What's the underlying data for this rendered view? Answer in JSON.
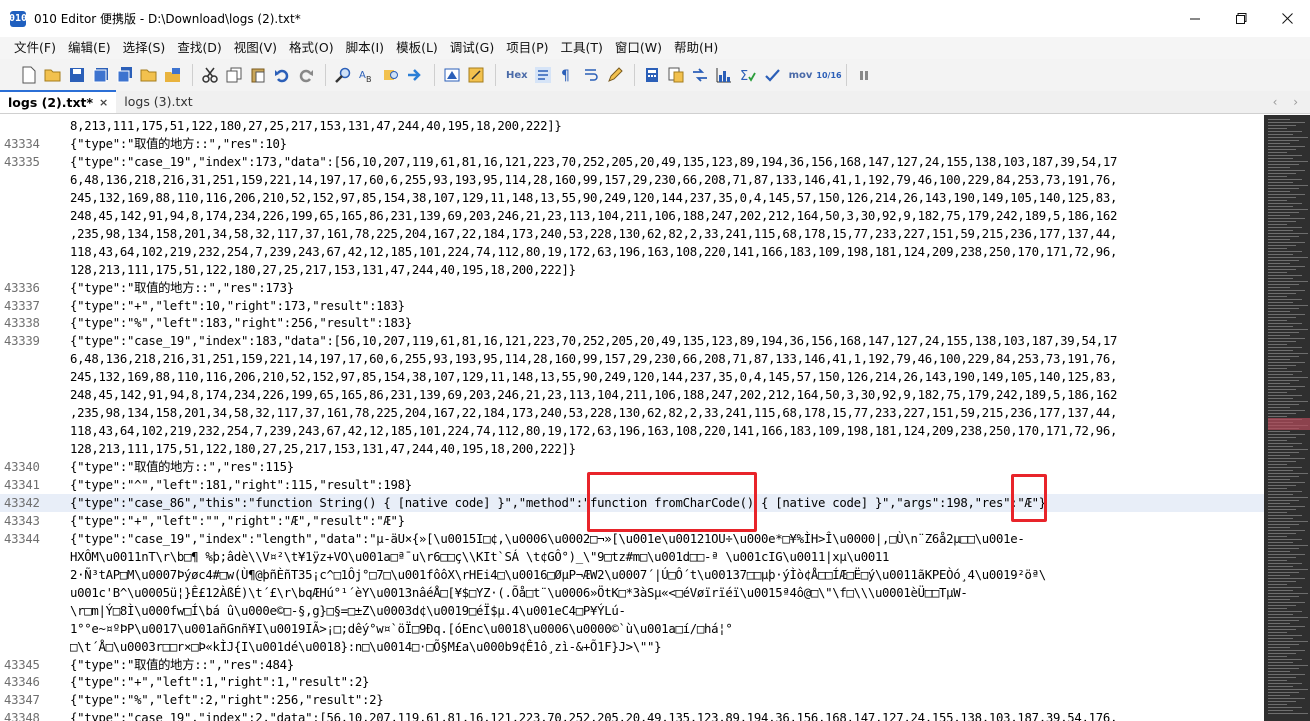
{
  "window": {
    "title": "010 Editor 便携版 - D:\\Download\\logs (2).txt*",
    "app_icon": "010"
  },
  "menu": [
    "文件(F)",
    "编辑(E)",
    "选择(S)",
    "查找(D)",
    "视图(V)",
    "格式(O)",
    "脚本(I)",
    "模板(L)",
    "调试(G)",
    "项目(P)",
    "工具(T)",
    "窗口(W)",
    "帮助(H)"
  ],
  "toolbar": {
    "hex_label": "Hex",
    "mov_label": "mov",
    "base_label": "10/16"
  },
  "tabs": [
    {
      "label": "logs (2).txt*",
      "active": true,
      "close": "×"
    },
    {
      "label": "logs (3).txt",
      "active": false,
      "close": ""
    }
  ],
  "editor": {
    "lines": [
      {
        "num": "",
        "text": "8,213,111,175,51,122,180,27,25,217,153,131,47,244,40,195,18,200,222]}"
      },
      {
        "num": "43334",
        "text": "{\"type\":\"取值的地方::\",\"res\":10}"
      },
      {
        "num": "43335",
        "text": "{\"type\":\"case_19\",\"index\":173,\"data\":[56,10,207,119,61,81,16,121,223,70,252,205,20,49,135,123,89,194,36,156,168,147,127,24,155,138,103,187,39,54,17"
      },
      {
        "num": "",
        "text": "6,48,136,218,216,31,251,159,221,14,197,17,60,6,255,93,193,95,114,28,160,99,157,29,230,66,208,71,87,133,146,41,1,192,79,46,100,229,84,253,73,191,76,"
      },
      {
        "num": "",
        "text": "245,132,169,88,110,116,206,210,52,152,97,85,154,38,107,129,11,148,13,55,90,249,120,144,237,35,0,4,145,57,150,126,214,26,143,190,149,105,140,125,83,"
      },
      {
        "num": "",
        "text": "248,45,142,91,94,8,174,234,226,199,65,165,86,231,139,69,203,246,21,23,113,104,211,106,188,247,202,212,164,50,3,30,92,9,182,75,179,242,189,5,186,162"
      },
      {
        "num": "",
        "text": ",235,98,134,158,201,34,58,32,117,37,161,78,225,204,167,22,184,173,240,53,228,130,62,82,2,33,241,115,68,178,15,77,233,227,151,59,215,236,177,137,44,"
      },
      {
        "num": "",
        "text": "118,43,64,102,219,232,254,7,239,243,67,42,12,185,101,224,74,112,80,19,172,63,196,163,108,220,141,166,183,109,198,181,124,209,238,250,170,171,72,96,"
      },
      {
        "num": "",
        "text": "128,213,111,175,51,122,180,27,25,217,153,131,47,244,40,195,18,200,222]}"
      },
      {
        "num": "43336",
        "text": "{\"type\":\"取值的地方::\",\"res\":173}"
      },
      {
        "num": "43337",
        "text": "{\"type\":\"+\",\"left\":10,\"right\":173,\"result\":183}"
      },
      {
        "num": "43338",
        "text": "{\"type\":\"%\",\"left\":183,\"right\":256,\"result\":183}"
      },
      {
        "num": "43339",
        "text": "{\"type\":\"case_19\",\"index\":183,\"data\":[56,10,207,119,61,81,16,121,223,70,252,205,20,49,135,123,89,194,36,156,168,147,127,24,155,138,103,187,39,54,17"
      },
      {
        "num": "",
        "text": "6,48,136,218,216,31,251,159,221,14,197,17,60,6,255,93,193,95,114,28,160,99,157,29,230,66,208,71,87,133,146,41,1,192,79,46,100,229,84,253,73,191,76,"
      },
      {
        "num": "",
        "text": "245,132,169,88,110,116,206,210,52,152,97,85,154,38,107,129,11,148,13,55,90,249,120,144,237,35,0,4,145,57,150,126,214,26,143,190,149,105,140,125,83,"
      },
      {
        "num": "",
        "text": "248,45,142,91,94,8,174,234,226,199,65,165,86,231,139,69,203,246,21,23,113,104,211,106,188,247,202,212,164,50,3,30,92,9,182,75,179,242,189,5,186,162"
      },
      {
        "num": "",
        "text": ",235,98,134,158,201,34,58,32,117,37,161,78,225,204,167,22,184,173,240,53,228,130,62,82,2,33,241,115,68,178,15,77,233,227,151,59,215,236,177,137,44,"
      },
      {
        "num": "",
        "text": "118,43,64,102,219,232,254,7,239,243,67,42,12,185,101,224,74,112,80,19,172,63,196,163,108,220,141,166,183,109,198,181,124,209,238,250,170,171,72,96,"
      },
      {
        "num": "",
        "text": "128,213,111,175,51,122,180,27,25,217,153,131,47,244,40,195,18,200,222]}"
      },
      {
        "num": "43340",
        "text": "{\"type\":\"取值的地方::\",\"res\":115}"
      },
      {
        "num": "43341",
        "text": "{\"type\":\"^\",\"left\":181,\"right\":115,\"result\":198}"
      },
      {
        "num": "43342",
        "text": "{\"type\":\"case_86\",\"this\":\"function String() { [native code] }\",\"method\":\"function fromCharCode() { [native code] }\",\"args\":198,\"res\":\"Æ\"}"
      },
      {
        "num": "43343",
        "text": "{\"type\":\"+\",\"left\":\"\",\"right\":\"Æ\",\"result\":\"Æ\"}"
      },
      {
        "num": "43344",
        "text": "{\"type\":\"case_19\",\"index\":\"length\",\"data\":\"µ-äU×{»[\\u0015I□¢,\\u0006\\u0002□¬»[\\u001e\\u00121OU÷\\u000e*□¥%ÌH>Î\\u0000|,□Ù\\n¨Z6å2µ□□\\u001e-"
      },
      {
        "num": "",
        "text": "HXÔM\\u0011nT\\r\\b□¶ %þ;âdè\\\\V¤²\\t¥1ÿz+VO\\u001a□ª¯u\\r6□□ç\\\\KIt`SÁ \\t¢GÔ°)_\\\"9□tz#m□\\u001d□□-ª \\u001cIG\\u0011|xµ\\u0011"
      },
      {
        "num": "",
        "text": "2·Ñ³tAP□M\\u0007Þýøc4#□w(Ù¶@þñÈñT35¡c^□1Ôj°□7□\\u001fôôX\\rHEi4□\\u0016□ØµP¬ÆW2\\u0007´|Ú□Ô´t\\u00137□□µþ·ýÌò¢Å□□ÍÆ□Ë□ý\\u0011ãKPEÒó¸4\\u0019²öª\\"
      },
      {
        "num": "",
        "text": "u001c'B^\\u0005ü¦}Ê£12ÀßÉ)\\t´£\\r\\bqÆHú°¹´èY\\u0013nâéÅ□[¥$□YZ·(.Õå□t¨\\u0006»ÖtK□*3àSµ«<□éVøïrïéï\\u0015ª4ô@□\\\"\\f□\\\\\\u0001èÜ□□TµW-"
      },
      {
        "num": "",
        "text": "\\r□m|Ý□8Ì\\u000fw□Í\\bá û\\u000e©□-§,g}□§=□±Z\\u0003d¢\\u0019□éÏ$µ.4\\u001eC4□P¥ÝLú-"
      },
      {
        "num": "",
        "text": "1°°e~¤ºÞP\\u0017\\u001añGnñ¥I\\u0019IÃ>¡□;dêý°w¤`öÏ□9Ðq.[óEnc\\u0018\\u0006\\u0000©`ù\\u001a□í/□há¦°"
      },
      {
        "num": "",
        "text": "□\\t´Å□\\u0003r□□r×□Þ«kÌJ{I\\u001dé\\u0018}:n□\\u0014□·□Õ§M£a\\u000b9¢Ê1ô¸zì-&+Õ1F}J>\\\"\"}"
      },
      {
        "num": "43345",
        "text": "{\"type\":\"取值的地方::\",\"res\":484}"
      },
      {
        "num": "43346",
        "text": "{\"type\":\"+\",\"left\":1,\"right\":1,\"result\":2}"
      },
      {
        "num": "43347",
        "text": "{\"type\":\"%\",\"left\":2,\"right\":256,\"result\":2}"
      },
      {
        "num": "43348",
        "text": "{\"type\":\"case_19\",\"index\":2,\"data\":[56,10,207,119,61,81,16,121,223,70,252,205,20,49,135,123,89,194,36,156,168,147,127,24,155,138,103,187,39,54,176,"
      }
    ]
  },
  "colors": {
    "highlight_border": "#e8242a",
    "selection": "#3b78d8",
    "current_line": "#e8eef8"
  }
}
